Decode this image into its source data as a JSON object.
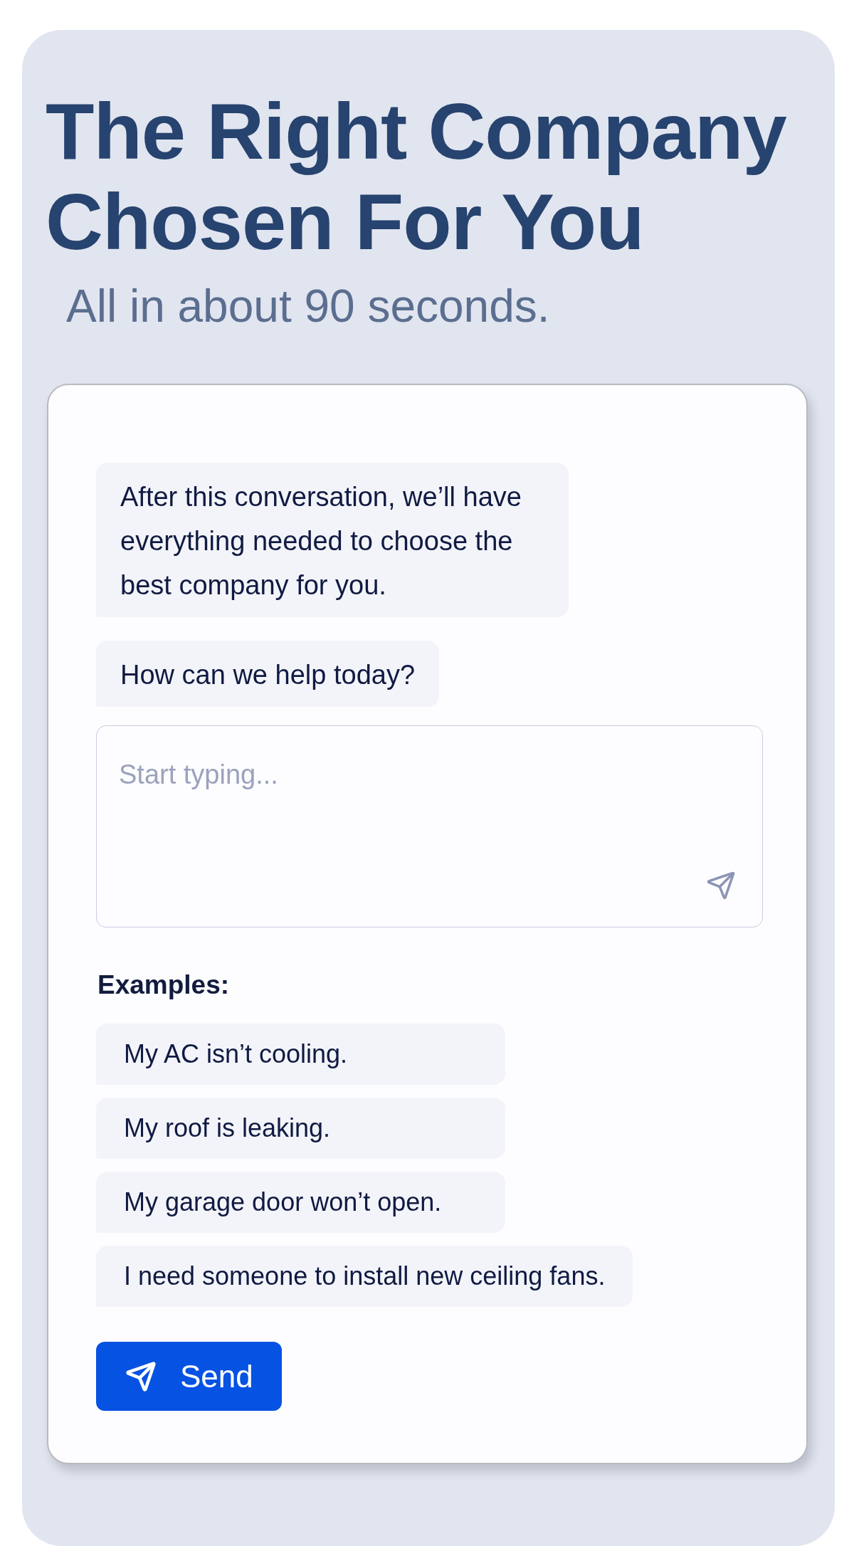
{
  "header": {
    "title": "The Right Company Chosen For You",
    "subtitle": "All in about 90 seconds."
  },
  "chat": {
    "messages": [
      "After this conversation, we’ll have everything needed to choose the best company for you.",
      "How can we help today?"
    ],
    "input": {
      "placeholder": "Start typing..."
    },
    "examples": {
      "label": "Examples:",
      "items": [
        "My AC isn’t cooling.",
        "My roof is leaking.",
        "My garage door won’t open.",
        "I need someone to install new ceiling fans."
      ]
    },
    "send_button": {
      "label": "Send"
    }
  }
}
